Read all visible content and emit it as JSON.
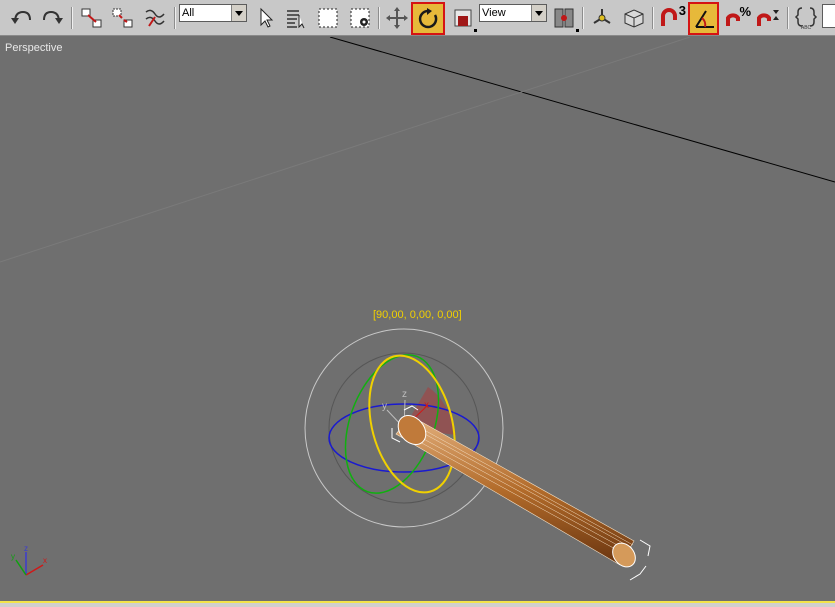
{
  "toolbar": {
    "selection_filter": "All",
    "reference_coordinate_system": "View",
    "active_tool": "select-and-rotate",
    "snap_count": "3",
    "percent_snap": "%",
    "colors": {
      "active_bg": "#e7b93a",
      "active_border": "#d51414"
    },
    "icons": [
      "undo-icon",
      "redo-icon",
      "select-and-link-icon",
      "unlink-selection-icon",
      "bind-to-space-warp-icon",
      "select-object-icon",
      "select-by-name-icon",
      "rectangular-selection-region-icon",
      "window-crossing-icon",
      "select-and-move-icon",
      "select-and-rotate-icon",
      "select-and-scale-icon",
      "use-pivot-point-center-icon",
      "select-and-manipulate-icon",
      "keyboard-shortcut-override-icon",
      "snaps-toggle-icon",
      "angle-snap-toggle-icon",
      "percent-snap-toggle-icon",
      "spinner-snap-toggle-icon",
      "edit-named-selection-sets-icon"
    ]
  },
  "viewport": {
    "label": "Perspective",
    "gizmo_readout": "[90,00, 0,00, 0,00]",
    "axis_labels": {
      "x": "x",
      "y": "y",
      "z": "z"
    },
    "colors": {
      "background": "#6f6f6f",
      "readout": "#f0d000",
      "x_axis": "#d01818",
      "y_axis": "#10b010",
      "z_axis": "#1a1ad0",
      "object_wire": "#b06a2a"
    }
  }
}
